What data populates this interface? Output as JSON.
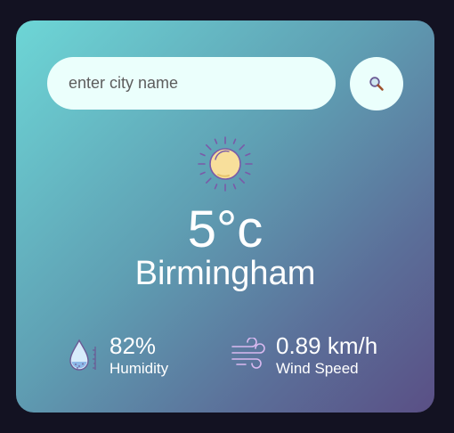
{
  "search": {
    "placeholder": "enter city name",
    "button_icon": "search-icon"
  },
  "weather": {
    "icon": "sun-icon",
    "temperature": "5°c",
    "city": "Birmingham"
  },
  "details": {
    "humidity": {
      "icon": "humidity-icon",
      "value": "82%",
      "label": "Humidity"
    },
    "wind": {
      "icon": "wind-icon",
      "value": "0.89 km/h",
      "label": "Wind Speed"
    }
  },
  "colors": {
    "background": "#131222",
    "card_gradient_start": "#6dd6d6",
    "card_gradient_end": "#5a4f85",
    "input_bg": "#ebfffc",
    "sun_fill": "#f8df9b",
    "icon_stroke": "#7a5aa8"
  }
}
